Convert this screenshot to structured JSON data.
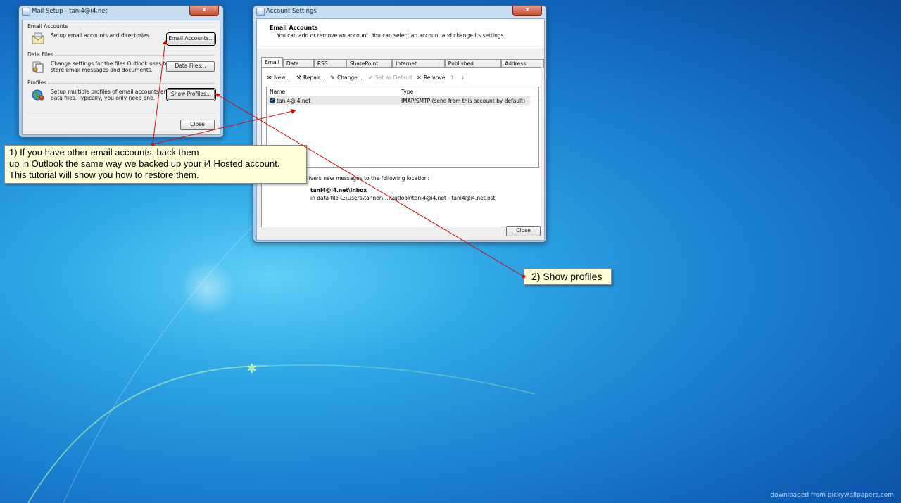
{
  "mail_setup": {
    "title": "Mail Setup - tani4@i4.net",
    "close_glyph": "x",
    "email_accounts": {
      "section": "Email Accounts",
      "description": "Setup email accounts and directories.",
      "button": "Email Accounts..."
    },
    "data_files": {
      "section": "Data Files",
      "description_line1": "Change settings for the files Outlook uses to",
      "description_line2": "store email messages and documents.",
      "button": "Data Files..."
    },
    "profiles": {
      "section": "Profiles",
      "description_line1": "Setup multiple profiles of email accounts and",
      "description_line2": "data files. Typically, you only need one.",
      "button": "Show Profiles..."
    },
    "close_button": "Close"
  },
  "account_settings": {
    "title": "Account Settings",
    "close_glyph": "x",
    "header_title": "Email Accounts",
    "header_subtitle": "You can add or remove an account. You can select an account and change its settings.",
    "tabs": [
      "Email",
      "Data Files",
      "RSS Feeds",
      "SharePoint Lists",
      "Internet Calendars",
      "Published Calendars",
      "Address Books"
    ],
    "toolbar": {
      "new": "New...",
      "repair": "Repair...",
      "change": "Change...",
      "set_default": "Set as Default",
      "remove": "Remove"
    },
    "columns": {
      "name": "Name",
      "type": "Type"
    },
    "accounts": [
      {
        "name": "tani4@i4.net",
        "type": "IMAP/SMTP (send from this account by default)"
      }
    ],
    "delivery_text": "elivers new messages to the following location:",
    "delivery_folder": "tani4@i4.net\\Inbox",
    "delivery_file": "in data file C:\\Users\\tanner\\...\\Outlook\\tani4@i4.net - tani4@i4.net.ost",
    "close_button": "Close"
  },
  "callouts": {
    "step1_line1": "1) If you have other email accounts, back them",
    "step1_line2": "up in Outlook the same way we backed up your i4 Hosted account.",
    "step1_line3": "This tutorial will show you how to restore them.",
    "step2": "2) Show profiles"
  },
  "colors": {
    "annotation_red": "#cc1010",
    "callout_bg": "#ffffd8"
  },
  "watermark": "downloaded from pickywallpapers.com"
}
